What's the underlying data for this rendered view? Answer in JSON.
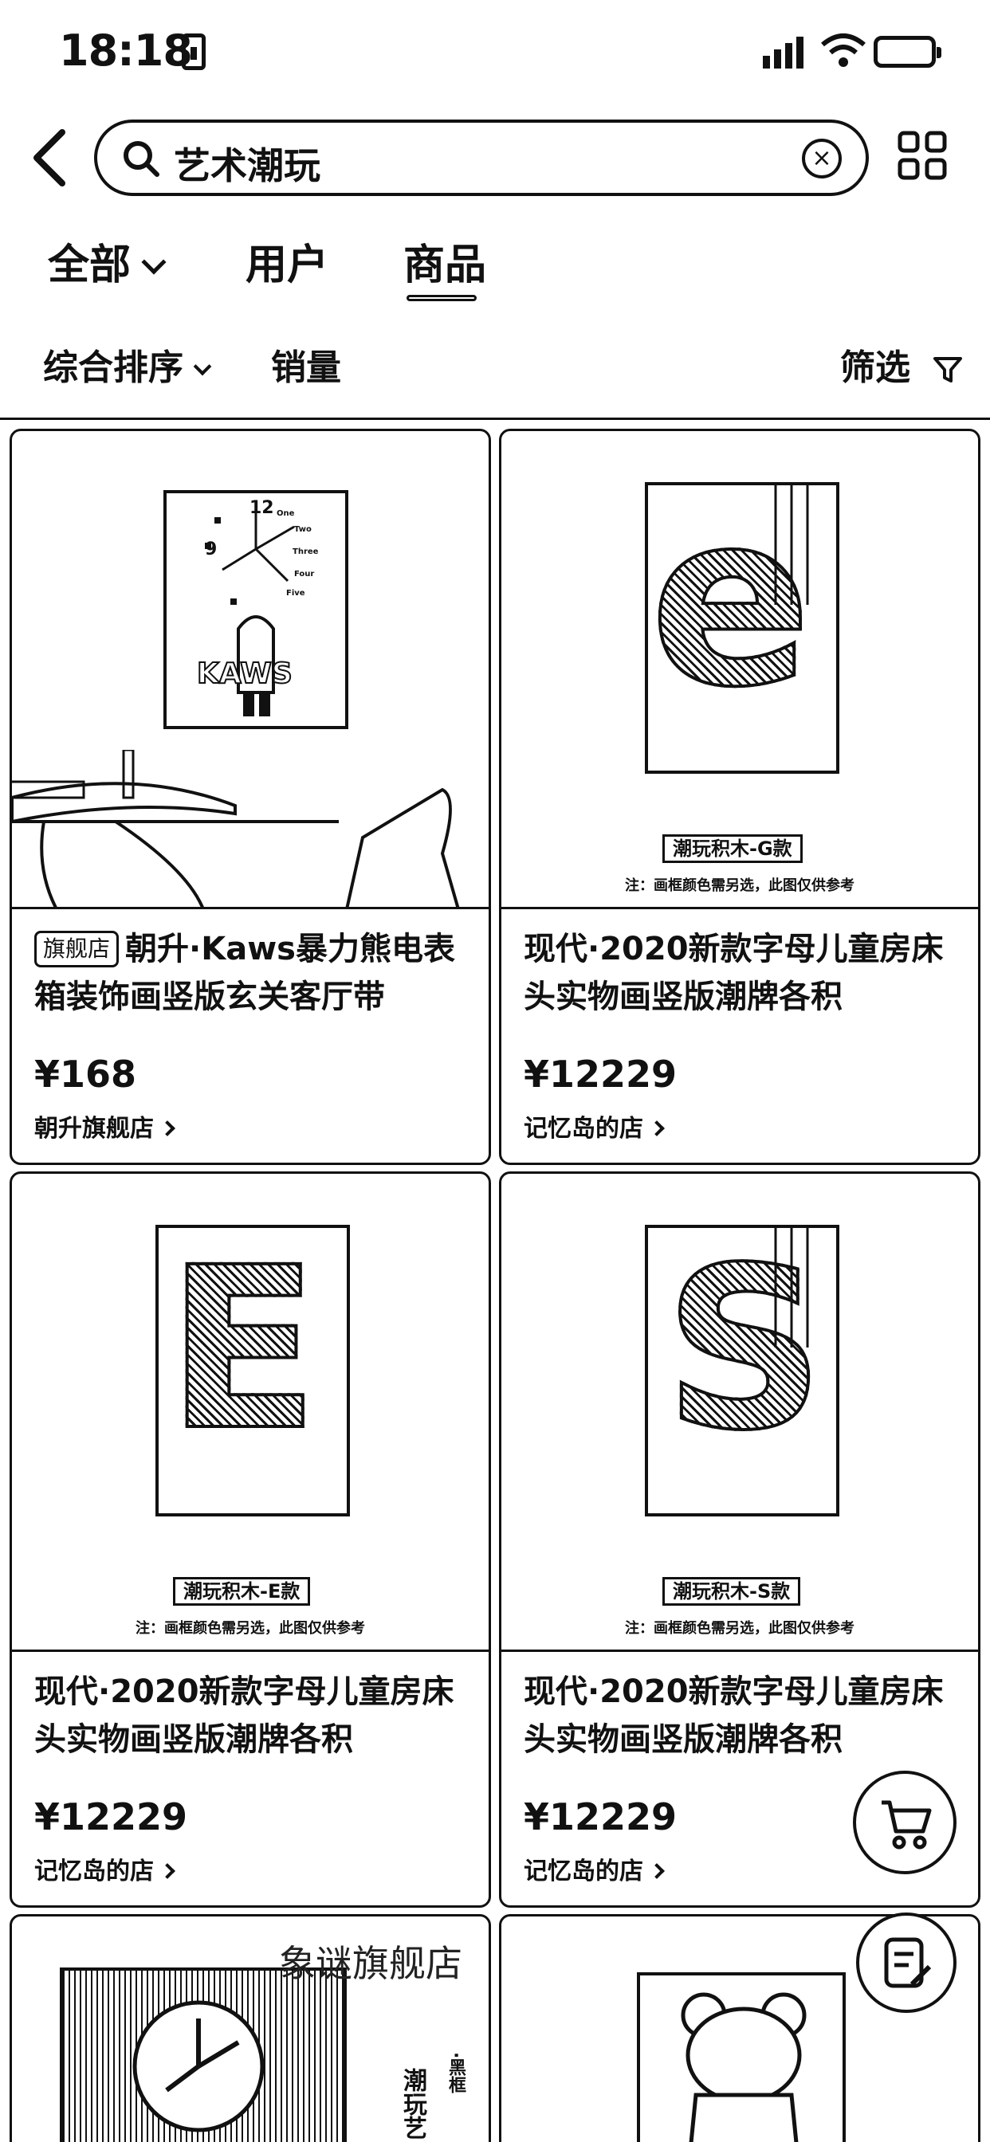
{
  "status_bar": {
    "time": "18:18"
  },
  "search": {
    "query": "艺术潮玩",
    "clear_symbol": "×"
  },
  "tabs": [
    {
      "label": "全部"
    },
    {
      "label": "用户"
    },
    {
      "label": "商品"
    }
  ],
  "sort": {
    "overall": "综合排序",
    "sales": "销量",
    "filter": "筛选"
  },
  "products": [
    {
      "badge": "旗舰店",
      "title": "朝升·Kaws暴力熊电表箱装饰画竖版玄关客厅带",
      "price": "¥168",
      "shop": "朝升旗舰店",
      "image_text": "KAWS",
      "clock_numbers": [
        "12",
        "One",
        "Two",
        "Three",
        "Four",
        "Five",
        "9"
      ]
    },
    {
      "badge": "",
      "title": "现代·2020新款字母儿童房床头实物画竖版潮牌各积",
      "price": "¥12229",
      "shop": "记忆岛的店",
      "letter": "e",
      "image_label": "潮玩积木-G款",
      "image_note": "注：画框颜色需另选，此图仅供参考"
    },
    {
      "badge": "",
      "title": "现代·2020新款字母儿童房床头实物画竖版潮牌各积",
      "price": "¥12229",
      "shop": "记忆岛的店",
      "letter": "E",
      "image_label": "潮玩积木-E款",
      "image_note": "注：画框颜色需另选，此图仅供参考"
    },
    {
      "badge": "",
      "title": "现代·2020新款字母儿童房床头实物画竖版潮牌各积",
      "price": "¥12229",
      "shop": "记忆岛的店",
      "letter": "S",
      "image_label": "潮玩积木-S款",
      "image_note": "注：画框颜色需另选，此图仅供参考"
    }
  ],
  "partial_cards": {
    "left_overlay": "象谜旗舰店",
    "left_side_text": "潮玩艺",
    "left_side_text2": "·黑框"
  },
  "icons": {
    "back": "chevron-left-icon",
    "search": "search-icon",
    "grid": "grid-icon",
    "cart": "cart-icon",
    "edit": "edit-note-icon",
    "filter": "funnel-icon"
  }
}
